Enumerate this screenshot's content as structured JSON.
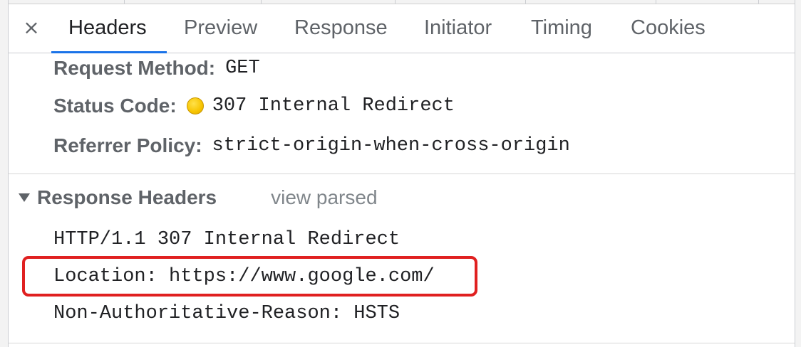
{
  "tabs": {
    "close_symbol": "×",
    "items": [
      {
        "label": "Headers",
        "active": true
      },
      {
        "label": "Preview",
        "active": false
      },
      {
        "label": "Response",
        "active": false
      },
      {
        "label": "Initiator",
        "active": false
      },
      {
        "label": "Timing",
        "active": false
      },
      {
        "label": "Cookies",
        "active": false
      }
    ]
  },
  "general": {
    "request_method_label": "Request Method:",
    "request_method_value": "GET",
    "status_code_label": "Status Code:",
    "status_code_value": "307 Internal Redirect",
    "status_color": "#f7c400",
    "referrer_policy_label": "Referrer Policy:",
    "referrer_policy_value": "strict-origin-when-cross-origin"
  },
  "response_headers": {
    "title": "Response Headers",
    "toggle_label": "view parsed",
    "lines": [
      "HTTP/1.1 307 Internal Redirect",
      "Location: https://www.google.com/",
      "Non-Authoritative-Reason: HSTS"
    ]
  },
  "highlight_color": "#e02020",
  "accent_color": "#1a73e8"
}
